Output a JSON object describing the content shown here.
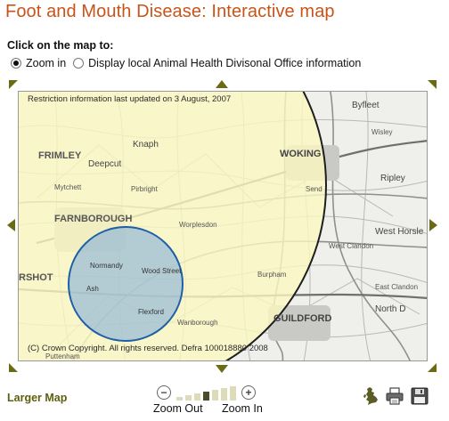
{
  "page_title": "Foot and Mouth Disease: Interactive map",
  "instructions": {
    "heading": "Click on the map to:",
    "modes": [
      {
        "label": "Zoom in",
        "selected": true
      },
      {
        "label": "Display local Animal Health Divisonal Office information",
        "selected": false
      }
    ]
  },
  "map": {
    "update_notice": "Restriction information last updated on 3 August, 2007",
    "copyright": "(C) Crown Copyright. All rights reserved. Defra 100018880 2008",
    "place_labels": {
      "frimley": "FRIMLEY",
      "farnborough": "FARNBOROUGH",
      "rshot": "RSHOT",
      "woking": "WOKING",
      "guildford": "GUILDFORD",
      "byfleet": "Byfleet",
      "ripley": "Ripley",
      "west_horsley": "West Horsle",
      "west_clandon": "West Clandon",
      "east_clandon": "East Clandon",
      "north": "North D",
      "knaphill": "Knaph",
      "deepcut": "Deepcut",
      "normandy": "Normandy",
      "pirbright": "Pirbright",
      "worplesdon": "Worplesdon",
      "mytchett": "Mytchett",
      "wisley": "Wisley",
      "send": "Send",
      "burpham": "Burpham",
      "wood_street": "Wood Street",
      "ash": "Ash",
      "flexford": "Flexford",
      "wanborough": "Wanborough",
      "puttenham": "Puttenham"
    },
    "zones": {
      "protection_fill": "#fbf7c0",
      "surveillance_fill": "#7aa9dd",
      "surveillance_stroke": "#1f5fa8"
    }
  },
  "navigation": {
    "pan_arrow_color": "#6b6b14"
  },
  "footer": {
    "larger_map": "Larger Map",
    "zoom_out": "Zoom Out",
    "zoom_in": "Zoom In",
    "zoom_out_symbol": "−",
    "zoom_in_symbol": "+",
    "zoom_levels": 7,
    "zoom_active_level": 4,
    "icons": [
      "uk-map-icon",
      "print-icon",
      "save-icon"
    ]
  }
}
